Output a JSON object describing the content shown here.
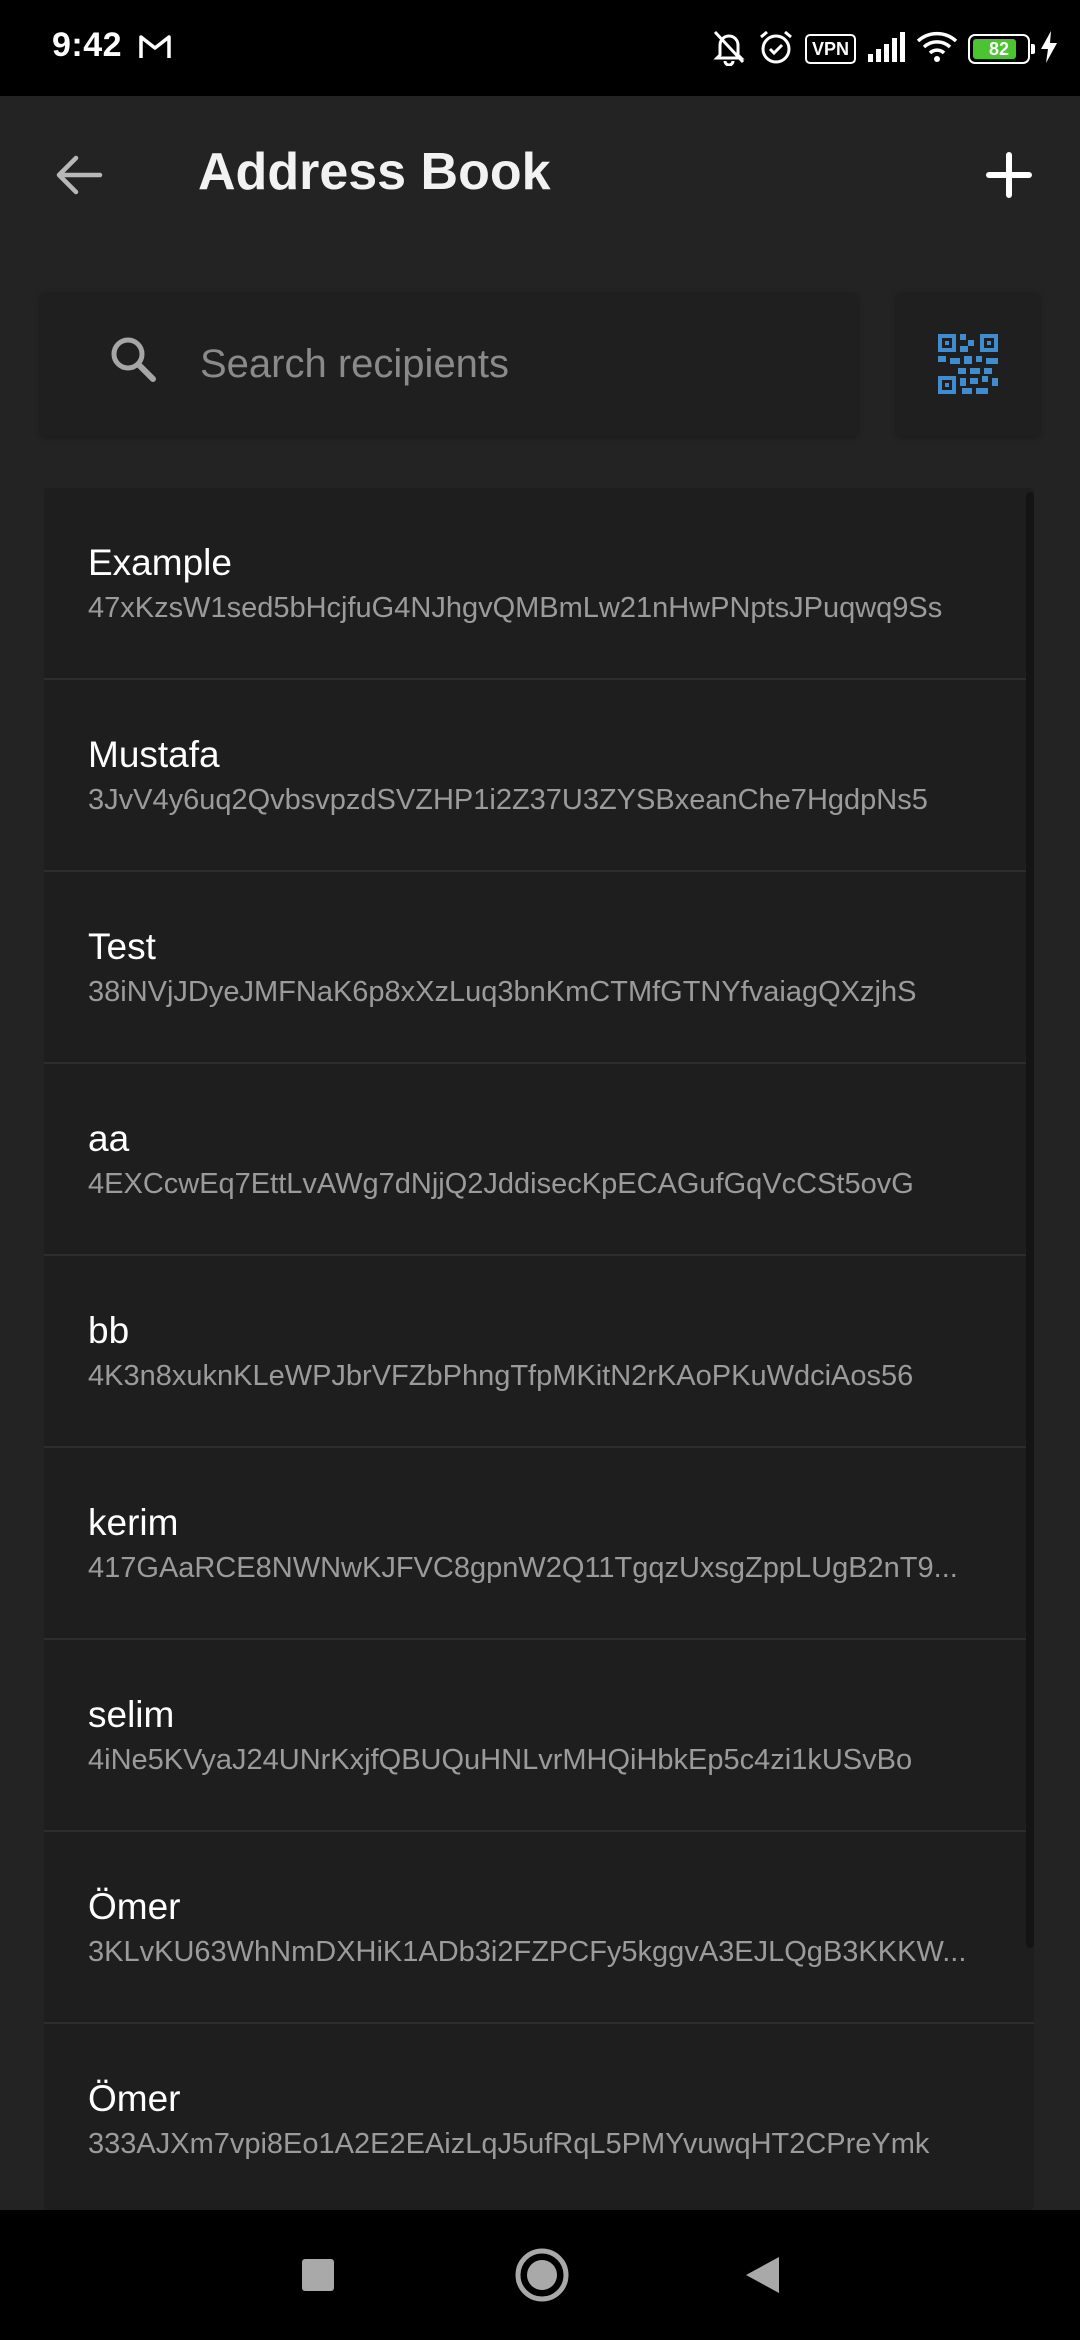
{
  "status_bar": {
    "time": "9:42",
    "vpn_label": "VPN",
    "battery_percent": "82",
    "battery_level": 0.82,
    "battery_color": "#4cc431",
    "icons": [
      "gmail-icon",
      "bell-off-icon",
      "alarm-icon",
      "vpn-icon",
      "signal-icon",
      "wifi-icon",
      "battery-icon",
      "charging-icon"
    ]
  },
  "header": {
    "title": "Address Book",
    "back_icon": "arrow-back-icon",
    "add_icon": "plus-icon"
  },
  "search": {
    "placeholder": "Search recipients",
    "value": "",
    "qr_icon": "qr-code-icon",
    "qr_color": "#3f8dd0"
  },
  "contacts": [
    {
      "name": "Example",
      "address": "47xKzsW1sed5bHcjfuG4NJhgvQMBmLw21nHwPNptsJPuqwq9Ss"
    },
    {
      "name": "Mustafa",
      "address": "3JvV4y6uq2QvbsvpzdSVZHP1i2Z37U3ZYSBxeanChe7HgdpNs5"
    },
    {
      "name": "Test",
      "address": "38iNVjJDyeJMFNaK6p8xXzLuq3bnKmCTMfGTNYfvaiagQXzjhS"
    },
    {
      "name": "aa",
      "address": "4EXCcwEq7EttLvAWg7dNjjQ2JddisecKpECAGufGqVcCSt5ovG"
    },
    {
      "name": "bb",
      "address": "4K3n8xuknKLeWPJbrVFZbPhngTfpMKitN2rKAoPKuWdciAos56"
    },
    {
      "name": "kerim",
      "address": "417GAaRCE8NWNwKJFVC8gpnW2Q11TgqzUxsgZppLUgB2nT9..."
    },
    {
      "name": "selim",
      "address": "4iNe5KVyaJ24UNrKxjfQBUQuHNLvrMHQiHbkEp5c4zi1kUSvBo"
    },
    {
      "name": "Ömer",
      "address": "3KLvKU63WhNmDXHiK1ADb3i2FZPCFy5kggvA3EJLQgB3KKKW..."
    },
    {
      "name": "Ömer",
      "address": "333AJXm7vpi8Eo1A2E2EAizLqJ5ufRqL5PMYvuwqHT2CPreYmk"
    }
  ],
  "nav_bar": {
    "recents_icon": "square-recents-icon",
    "home_icon": "circle-home-icon",
    "back_icon": "triangle-back-icon"
  }
}
